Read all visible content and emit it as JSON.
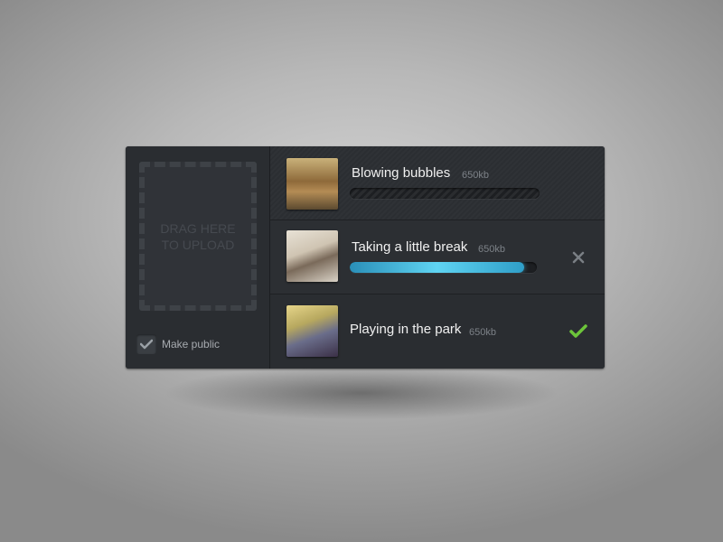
{
  "uploader": {
    "dropzone_text": "DRAG HERE\nTO UPLOAD",
    "make_public_label": "Make public",
    "make_public_checked": true
  },
  "uploads": [
    {
      "title": "Blowing bubbles",
      "size": "650kb",
      "status": "queued",
      "progress": 0
    },
    {
      "title": "Taking a little break",
      "size": "650kb",
      "status": "uploading",
      "progress": 0.93
    },
    {
      "title": "Playing in the park",
      "size": "650kb",
      "status": "complete",
      "progress": 1
    }
  ],
  "colors": {
    "accent": "#5fd4f2",
    "success": "#6cc43a",
    "panel": "#2c2f33"
  },
  "icons": {
    "cancel": "close-icon",
    "done": "checkmark-icon",
    "checkbox": "checkmark-icon"
  }
}
